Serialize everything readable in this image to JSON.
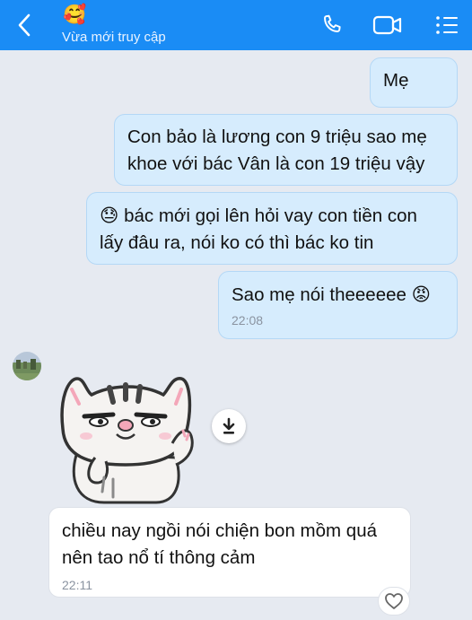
{
  "header": {
    "contact_emoji": "🥰",
    "status": "Vừa mới truy cập",
    "icons": [
      "back-icon",
      "phone-icon",
      "video-call-icon",
      "menu-list-icon"
    ]
  },
  "colors": {
    "header_bg": "#1a8cf5",
    "outgoing_bubble": "#d6ecfd",
    "incoming_bubble": "#ffffff",
    "chat_bg": "#e6eaf1"
  },
  "messages": [
    {
      "direction": "outgoing",
      "text": "Mẹ"
    },
    {
      "direction": "outgoing",
      "text": "Con bảo là lương con 9 triệu sao mẹ\nkhoe với bác Vân là con 19 triệu vậy"
    },
    {
      "direction": "outgoing",
      "emoji": "😓",
      "text": " bác mới gọi lên hỏi vay con tiền con\nlấy đâu ra, nói ko có thì bác ko tin"
    },
    {
      "direction": "outgoing",
      "text": "Sao mẹ nói theeeeee ",
      "emoji": "😡",
      "time": "22:08"
    },
    {
      "direction": "incoming",
      "text": "chiều nay ngồi nói chiện bon mồm quá\nnên tao nổ tí thông cảm",
      "time": "22:11"
    }
  ],
  "sticker": {
    "description_icon": "cat-sticker",
    "download_icon": "download-icon"
  },
  "reaction_icon": "heart-icon"
}
